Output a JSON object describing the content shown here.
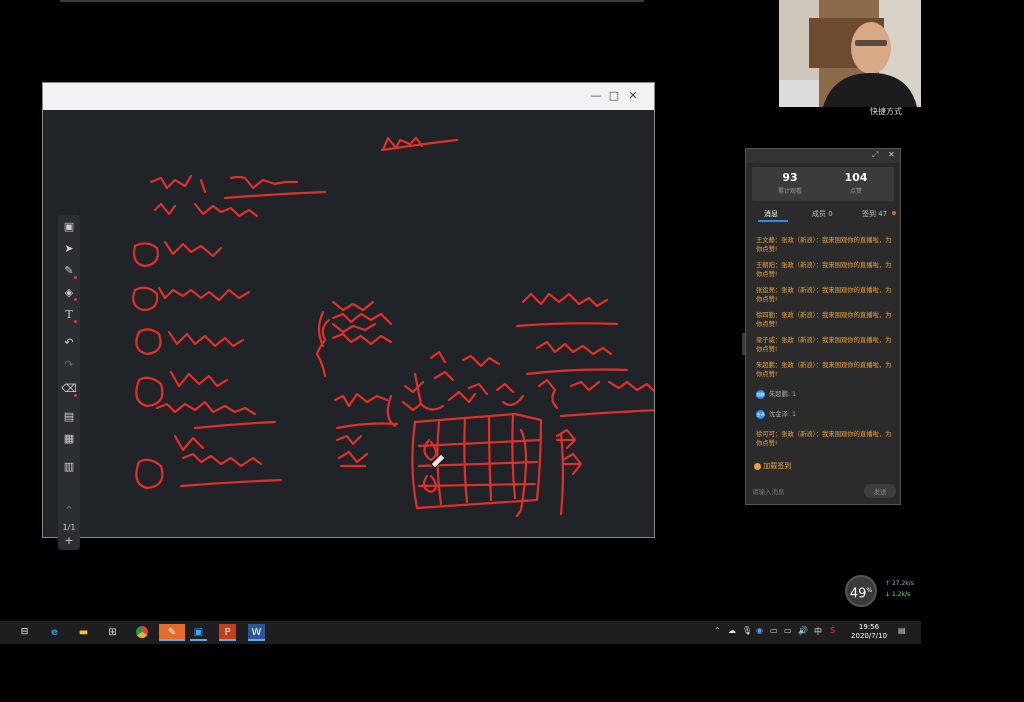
{
  "whiteboard": {
    "window_controls": [
      "—",
      "□",
      "✕"
    ],
    "page_indicator": "1/1",
    "tools": [
      "image-icon",
      "pointer-icon",
      "pen-icon",
      "shapes-icon",
      "text-icon",
      "undo-icon",
      "redo-icon",
      "eraser-icon",
      "toolbox-icon",
      "edit-icon",
      "save-icon"
    ],
    "ink_color": "#e0302c"
  },
  "video": {
    "label": "快捷方式"
  },
  "chat": {
    "stats": [
      {
        "value": "93",
        "label": "累计观看"
      },
      {
        "value": "104",
        "label": "点赞"
      }
    ],
    "tabs": {
      "messages": "消息",
      "members": "成员 0",
      "checkin": "签到 47"
    },
    "messages": [
      {
        "text": "王文静：张政（新浪）：我来围观你的直播啦，为你点赞!"
      },
      {
        "text": "王朝阳：张政（新浪）：我来围观你的直播啦，为你点赞!"
      },
      {
        "text": "张运亮：张政（新浪）：我来围观你的直播啦，为你点赞!"
      },
      {
        "text": "徐四勤：张政（新浪）：我来围观你的直播啦，为你点赞!"
      },
      {
        "text": "梁子威：张政（新浪）：我来围观你的直播啦，为你点赞!"
      },
      {
        "text": "朱超鹏：张政（新浪）：我来围观你的直播啦，为你点赞!"
      }
    ],
    "joins": [
      {
        "avatar": "超鹏",
        "text": "朱超鹏: 1"
      },
      {
        "avatar": "金泽",
        "text": "沈金泽: 1"
      }
    ],
    "last_message": "徐可可：张政（新浪）：我来围观你的直播啦，为你点赞!",
    "checkin": "加载签到",
    "input_placeholder": "请输入消息",
    "send_label": "发送"
  },
  "network": {
    "percent": "49",
    "unit": "%",
    "up": "27.2k/s",
    "down": "1.2k/s"
  },
  "taskbar": {
    "time": "19:56",
    "date": "2020/7/10",
    "ime": "中",
    "apps": [
      "task-view-icon",
      "edge-icon",
      "explorer-icon",
      "store-icon",
      "chrome-icon",
      "whiteboard-app-icon",
      "media-icon",
      "powerpoint-icon",
      "word-icon"
    ]
  }
}
